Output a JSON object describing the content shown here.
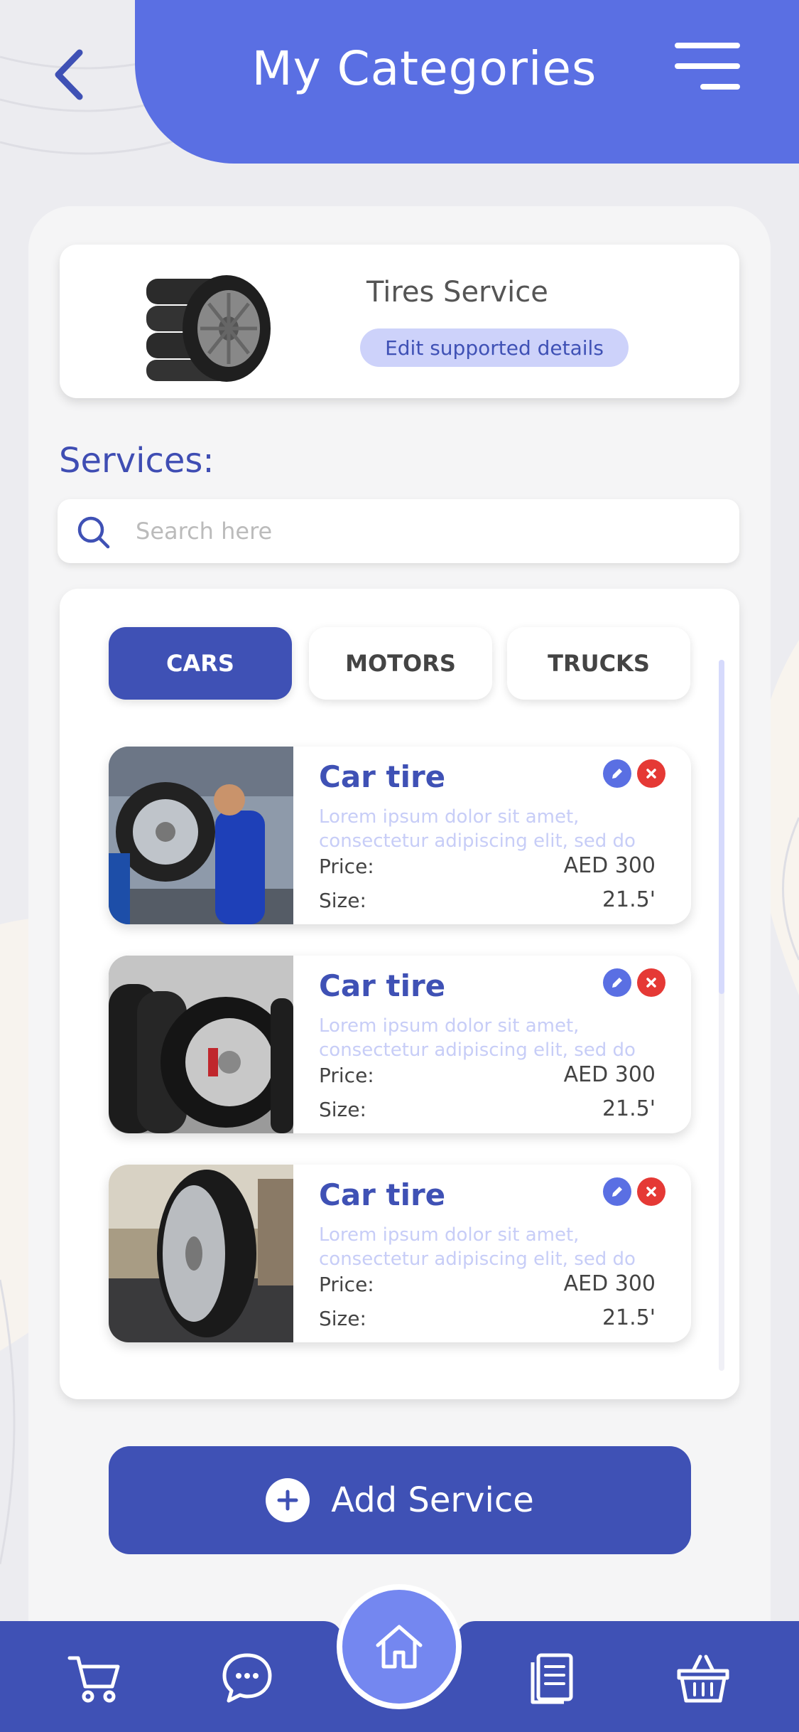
{
  "header": {
    "title": "My Categories"
  },
  "service": {
    "name": "Tires Service",
    "edit_label": "Edit supported details"
  },
  "services_label": "Services:",
  "search": {
    "placeholder": "Search here"
  },
  "tabs": [
    {
      "label": "CARS",
      "active": true
    },
    {
      "label": "MOTORS",
      "active": false
    },
    {
      "label": "TRUCKS",
      "active": false
    }
  ],
  "items": [
    {
      "title": "Car tire",
      "desc_line1": "Lorem ipsum dolor sit amet,",
      "desc_line2": "consectetur adipiscing elit, sed do",
      "price_label": "Price:",
      "price": "AED 300",
      "size_label": "Size:",
      "size": "21.5'"
    },
    {
      "title": "Car tire",
      "desc_line1": "Lorem ipsum dolor sit amet,",
      "desc_line2": "consectetur adipiscing elit, sed do",
      "price_label": "Price:",
      "price": "AED 300",
      "size_label": "Size:",
      "size": "21.5'"
    },
    {
      "title": "Car tire",
      "desc_line1": "Lorem ipsum dolor sit amet,",
      "desc_line2": "consectetur adipiscing elit, sed do",
      "price_label": "Price:",
      "price": "AED 300",
      "size_label": "Size:",
      "size": "21.5'"
    }
  ],
  "add_button": {
    "label": "Add Service"
  },
  "nav": {
    "items": [
      "cart-icon",
      "chat-icon",
      "home-icon",
      "document-icon",
      "basket-icon"
    ]
  },
  "colors": {
    "primary": "#5a6fe3",
    "primary_dark": "#3f51b5",
    "accent_light": "#cdd2fa",
    "delete": "#e53935"
  }
}
